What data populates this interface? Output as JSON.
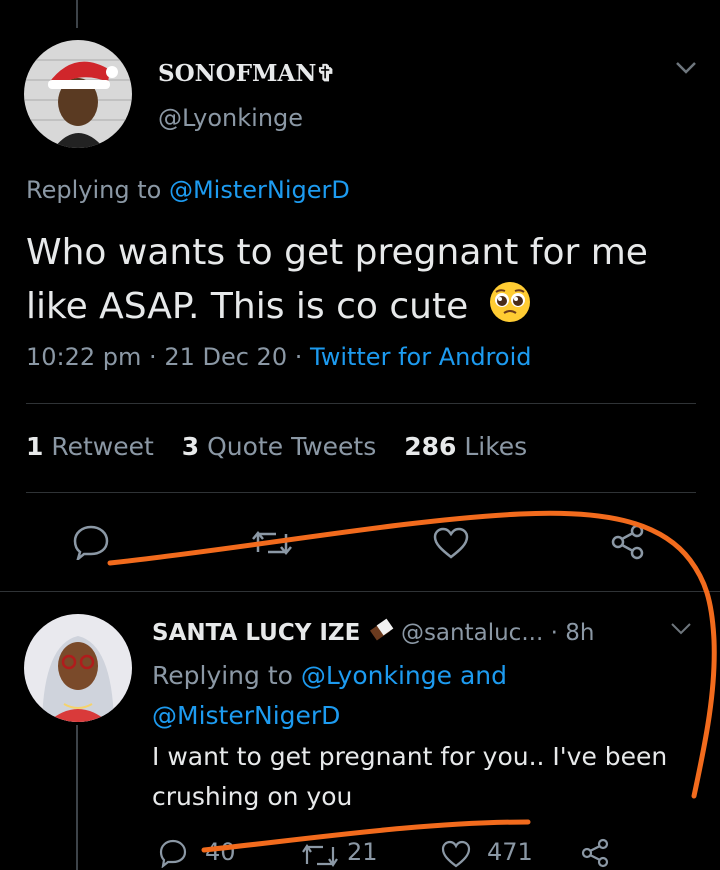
{
  "main_tweet": {
    "display_name": "SONOFMAN✞",
    "handle": "@Lyonkinge",
    "replying_prefix": "Replying to",
    "replying_to": "@MisterNigerD",
    "text": "Who wants to get pregnant for me like ASAP. This is co cute",
    "emoji": "pleading-face",
    "time": "10:22 pm",
    "date": "21 Dec 20",
    "source": "Twitter for Android",
    "retweets_count": "1",
    "retweets_label": "Retweet",
    "quotes_count": "3",
    "quotes_label": "Quote Tweets",
    "likes_count": "286",
    "likes_label": "Likes"
  },
  "reply_tweet": {
    "display_name": "SANTA LUCY IZE",
    "handle": "@santaluc...",
    "age": "· 8h",
    "replying_prefix": "Replying to",
    "replying_to_1": "@Lyonkinge",
    "and": "and",
    "replying_to_2": "@MisterNigerD",
    "text": "I want to get pregnant for you.. I've been crushing on you",
    "replies": "40",
    "retweets": "21",
    "likes": "471"
  },
  "colors": {
    "background": "#000000",
    "link": "#1d9bf0",
    "secondary_text": "#8b98a5",
    "annotation": "#f26b1d"
  }
}
